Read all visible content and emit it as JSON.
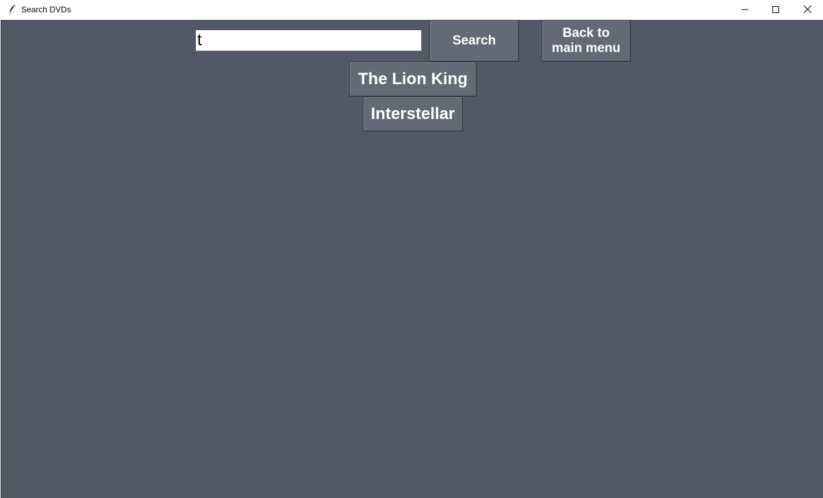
{
  "window": {
    "title": "Search DVDs",
    "app_icon": "feather-icon",
    "controls": {
      "minimize_icon": "minimize-icon",
      "maximize_icon": "maximize-icon",
      "close_icon": "close-icon"
    }
  },
  "search": {
    "value": "t",
    "button_label": "Search"
  },
  "nav": {
    "back_label": "Back to\nmain menu"
  },
  "results": [
    {
      "title": "The Lion King"
    },
    {
      "title": "Interstellar"
    }
  ],
  "colors": {
    "background": "#525866",
    "button": "#636977",
    "button_text": "#ffffff"
  }
}
